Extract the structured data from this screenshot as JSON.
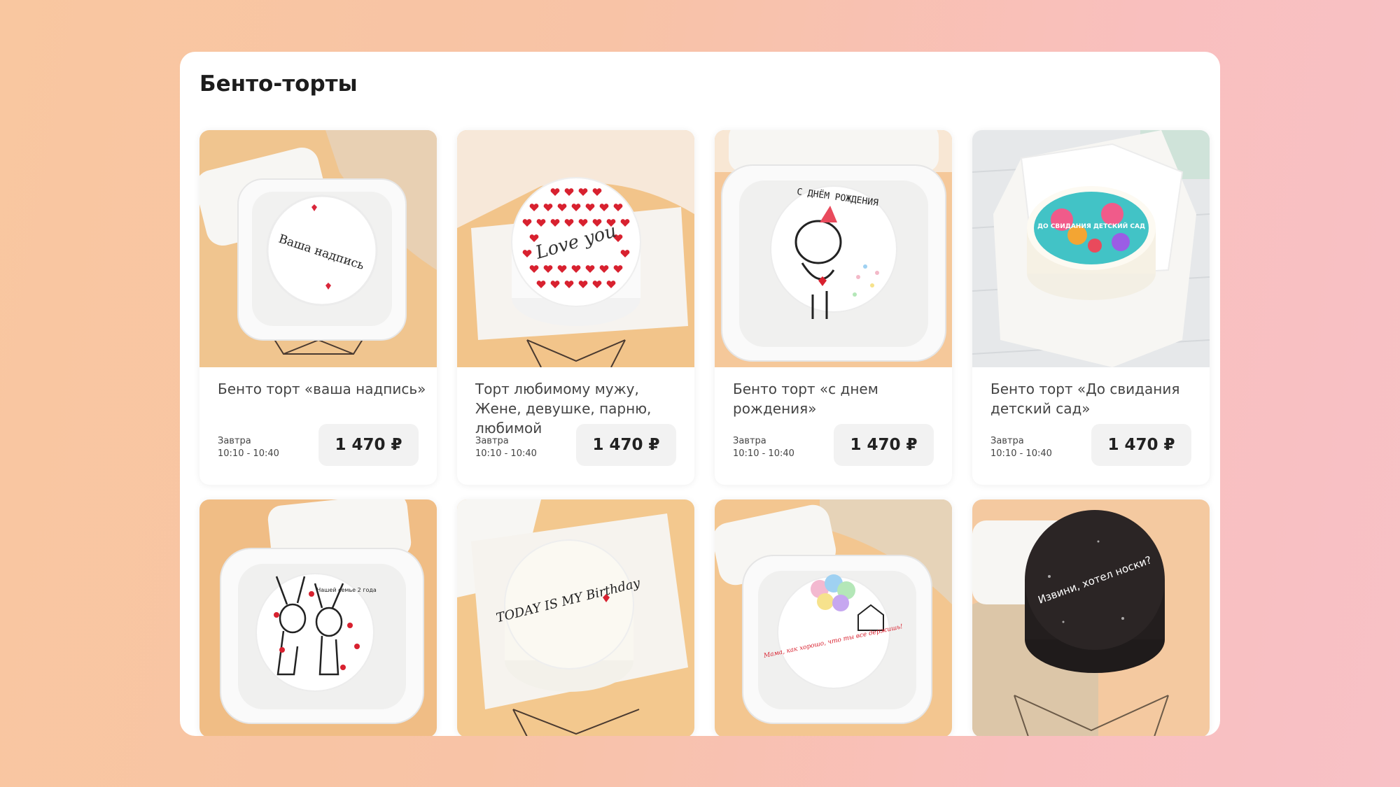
{
  "section": {
    "title": "Бенто-торты"
  },
  "products": [
    {
      "name": "Бенто торт «ваша надпись»",
      "delivery_day": "Завтра",
      "delivery_time": "10:10 - 10:40",
      "price": "1 470 ₽",
      "cake_text": "Ваша надпись",
      "background": "#f0c58f"
    },
    {
      "name": "Торт любимому мужу, Жене, девушке, парню, любимой",
      "delivery_day": "Завтра",
      "delivery_time": "10:10 - 10:40",
      "price": "1 470 ₽",
      "cake_text": "Love you",
      "background": "#f2c48a"
    },
    {
      "name": "Бенто торт «с днем рождения»",
      "delivery_day": "Завтра",
      "delivery_time": "10:10 - 10:40",
      "price": "1 470 ₽",
      "cake_text": "С ДНЁМ РОЖДЕНИЯ",
      "background": "#f5c89a"
    },
    {
      "name": "Бенто торт «До свидания детский сад»",
      "delivery_day": "Завтра",
      "delivery_time": "10:10 - 10:40",
      "price": "1 470 ₽",
      "cake_text": "ДО СВИДАНИЯ ДЕТСКИЙ САД",
      "background": "#e6e8ea"
    },
    {
      "cake_text": "Нашей семье 2 года",
      "background": "#f0bd85"
    },
    {
      "cake_text": "TODAY IS MY Birthday",
      "background": "#f3c88e"
    },
    {
      "cake_text": "Мама, как хорошо, что ты все держишь!",
      "background": "#f3c690"
    },
    {
      "cake_text": "Извини, хотел носки?",
      "background": "#f4c9a0"
    }
  ]
}
